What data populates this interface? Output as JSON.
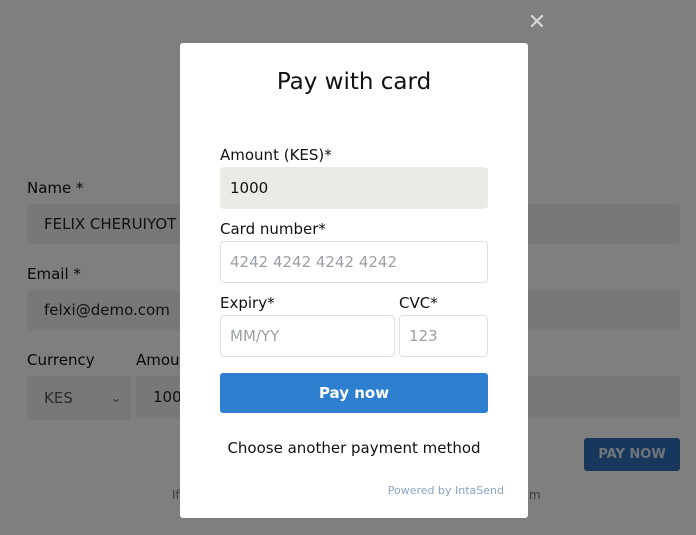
{
  "background": {
    "name_label": "Name *",
    "name_value": "FELIX CHERUIYOT",
    "email_label": "Email *",
    "email_value": "felxi@demo.com",
    "currency_label": "Currency",
    "currency_value": "KES",
    "amount_label": "Amou",
    "amount_value": "100",
    "pay_now_label": "PAY NOW",
    "footer_left": "If",
    "footer_right": "m"
  },
  "modal": {
    "title": "Pay with card",
    "amount_label": "Amount (KES)*",
    "amount_value": "1000",
    "card_label": "Card number*",
    "card_placeholder": "4242 4242 4242 4242",
    "expiry_label": "Expiry*",
    "expiry_placeholder": "MM/YY",
    "cvc_label": "CVC*",
    "cvc_placeholder": "123",
    "pay_button": "Pay now",
    "other_method": "Choose another payment method",
    "powered_by": "Powered by IntaSend"
  },
  "close_symbol": "✕",
  "colors": {
    "primary": "#2f7fd0",
    "overlay": "rgba(0,0,0,0.5)",
    "amount_bg": "#ebebe6"
  }
}
